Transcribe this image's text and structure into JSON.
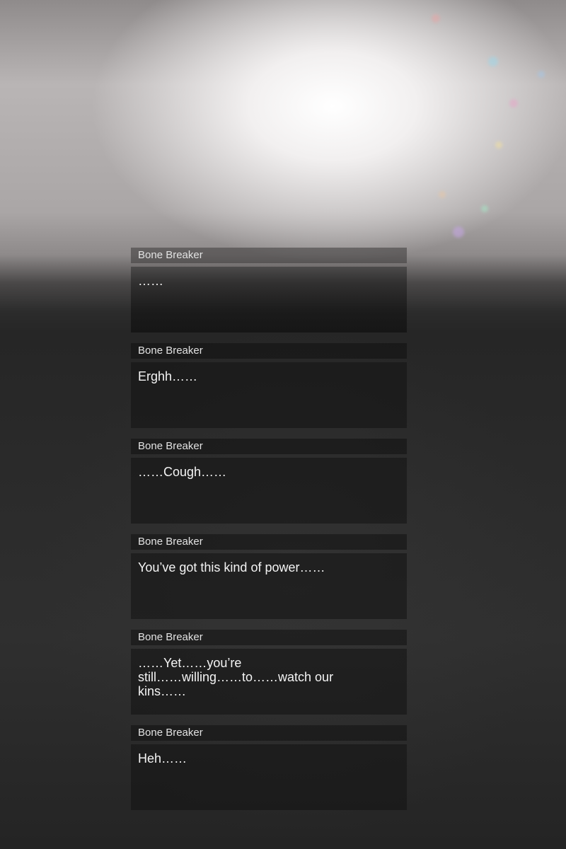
{
  "dialogue_log": {
    "entries": [
      {
        "speaker": "Bone Breaker",
        "text": "……"
      },
      {
        "speaker": "Bone Breaker",
        "text": "Erghh……"
      },
      {
        "speaker": "Bone Breaker",
        "text": "……Cough……"
      },
      {
        "speaker": "Bone Breaker",
        "text": "You’ve got this kind of power……"
      },
      {
        "speaker": "Bone Breaker",
        "text": "……Yet……you’re\nstill……willing……to……watch our\nkins……"
      },
      {
        "speaker": "Bone Breaker",
        "text": "Heh……"
      }
    ]
  }
}
